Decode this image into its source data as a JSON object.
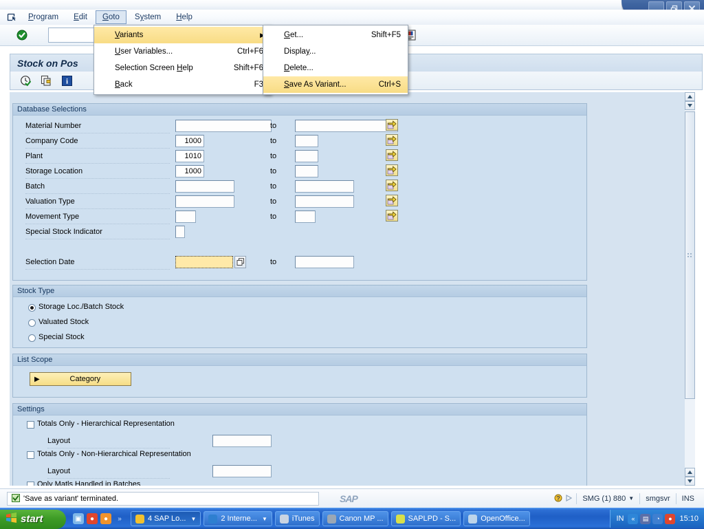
{
  "window": {
    "controls": [
      {
        "name": "minimize",
        "glyph": "minimize-icon"
      },
      {
        "name": "restore",
        "glyph": "restore-icon"
      },
      {
        "name": "close",
        "glyph": "close-icon"
      }
    ]
  },
  "menubar": {
    "system_icon": "system-menu-icon",
    "items": [
      {
        "label": "Program",
        "mnemonic": "P",
        "open": false
      },
      {
        "label": "Edit",
        "mnemonic": "E",
        "open": false
      },
      {
        "label": "Goto",
        "mnemonic": "G",
        "open": true
      },
      {
        "label": "System",
        "mnemonic": "y",
        "open": false
      },
      {
        "label": "Help",
        "mnemonic": "H",
        "open": false
      }
    ]
  },
  "goto_menu": {
    "items": [
      {
        "label": "Variants",
        "mnemonic": "V",
        "shortcut": "",
        "submenu": true,
        "selected": true
      },
      {
        "label": "User Variables...",
        "mnemonic": "U",
        "shortcut": "Ctrl+F6",
        "submenu": false,
        "selected": false
      },
      {
        "label": "Selection Screen Help",
        "mnemonic": "H",
        "shortcut": "Shift+F6",
        "submenu": false,
        "selected": false
      },
      {
        "label": "Back",
        "mnemonic": "B",
        "shortcut": "F3",
        "submenu": false,
        "selected": false
      }
    ]
  },
  "variants_submenu": {
    "items": [
      {
        "label": "Get...",
        "mnemonic": "G",
        "shortcut": "Shift+F5",
        "selected": false
      },
      {
        "label": "Display...",
        "mnemonic": "y",
        "shortcut": "",
        "selected": false
      },
      {
        "label": "Delete...",
        "mnemonic": "D",
        "shortcut": "",
        "selected": false
      },
      {
        "label": "Save As Variant...",
        "mnemonic": "S",
        "shortcut": "Ctrl+S",
        "selected": true
      }
    ]
  },
  "toolbar": {
    "enter_icon": "enter-check-icon",
    "command_field_value": "",
    "right_icons": [
      "help-icon",
      "layout-menu-icon"
    ]
  },
  "screen": {
    "title": "Stock on Pos",
    "app_icons": [
      "execute-clock-icon",
      "multiple-selection-icon",
      "info-icon"
    ]
  },
  "database_selections": {
    "header": "Database Selections",
    "to_label": "to",
    "rows": [
      {
        "label": "Material Number",
        "from": "",
        "to": "",
        "from_w": 140,
        "to_w": 150,
        "select_btn": true
      },
      {
        "label": "Company Code",
        "from": "1000",
        "to": "",
        "from_w": 42,
        "to_w": 34,
        "select_btn": true
      },
      {
        "label": "Plant",
        "from": "1010",
        "to": "",
        "from_w": 42,
        "to_w": 34,
        "select_btn": true
      },
      {
        "label": "Storage Location",
        "from": "1000",
        "to": "",
        "from_w": 42,
        "to_w": 34,
        "select_btn": true
      },
      {
        "label": "Batch",
        "from": "",
        "to": "",
        "from_w": 86,
        "to_w": 86,
        "select_btn": true
      },
      {
        "label": "Valuation Type",
        "from": "",
        "to": "",
        "from_w": 86,
        "to_w": 86,
        "select_btn": true
      },
      {
        "label": "Movement Type",
        "from": "",
        "to": "",
        "from_w": 30,
        "to_w": 30,
        "select_btn": true
      },
      {
        "label": "Special Stock Indicator",
        "from": "",
        "to": null,
        "from_w": 14,
        "to_w": 0,
        "select_btn": false
      }
    ],
    "selection_date": {
      "label": "Selection Date",
      "from": "",
      "to": "",
      "focused": true,
      "matchcode_icon": "matchcode-icon"
    }
  },
  "stock_type": {
    "header": "Stock Type",
    "options": [
      {
        "label": "Storage Loc./Batch Stock",
        "selected": true
      },
      {
        "label": "Valuated Stock",
        "selected": false
      },
      {
        "label": "Special Stock",
        "selected": false
      }
    ]
  },
  "list_scope": {
    "header": "List Scope",
    "category_button": {
      "label": "Category",
      "expand_icon": "triangle-right-icon"
    }
  },
  "settings": {
    "header": "Settings",
    "rows": [
      {
        "type": "checkbox",
        "label": "Totals Only - Hierarchical Representation",
        "checked": false
      },
      {
        "type": "field",
        "label": "Layout",
        "value": ""
      },
      {
        "type": "checkbox",
        "label": "Totals Only - Non-Hierarchical Representation",
        "checked": false
      },
      {
        "type": "field",
        "label": "Layout",
        "value": ""
      },
      {
        "type": "checkbox",
        "label": "Only Matls Handled in Batches",
        "checked": false
      }
    ]
  },
  "statusbar": {
    "message_icon": "status-success-icon",
    "message": "'Save as variant' terminated.",
    "sap_logo": "SAP",
    "help_icon": "help-question-icon",
    "servo_icon": "play-icon",
    "system": "SMG (1) 880",
    "server": "smgsvr",
    "insert_mode": "INS"
  },
  "taskbar": {
    "start_label": "start",
    "quick_launch": [
      {
        "name": "show-desktop-icon",
        "color": "#7fb7e8",
        "glyph": "▣"
      },
      {
        "name": "media-player-icon",
        "color": "#e0462d",
        "glyph": "●"
      },
      {
        "name": "chrome-icon",
        "color": "#f0932b",
        "glyph": "●"
      },
      {
        "name": "more-chevron-icon",
        "color": "transparent",
        "glyph": "»"
      }
    ],
    "buttons": [
      {
        "label": "4 SAP Lo...",
        "icon": "sap-folder-icon",
        "icon_color": "#f2c12e",
        "active": true,
        "dropdown": true
      },
      {
        "label": "2 Interne...",
        "icon": "ie-icon",
        "icon_color": "#2e7fd0",
        "active": false,
        "dropdown": true
      },
      {
        "label": "iTunes",
        "icon": "itunes-icon",
        "icon_color": "#c9d4e2",
        "active": false,
        "dropdown": false
      },
      {
        "label": "Canon MP ...",
        "icon": "printer-icon",
        "icon_color": "#9aa7b5",
        "active": false,
        "dropdown": false
      },
      {
        "label": "SAPLPD - S...",
        "icon": "saplpd-icon",
        "icon_color": "#d8e04a",
        "active": false,
        "dropdown": false
      },
      {
        "label": "OpenOffice...",
        "icon": "openoffice-icon",
        "icon_color": "#bcd4ea",
        "active": false,
        "dropdown": false
      }
    ],
    "tray": {
      "language": "IN",
      "icons": [
        {
          "name": "tray-chevron-icon",
          "color": "#2e86d8",
          "glyph": "«"
        },
        {
          "name": "network-icon",
          "color": "#5b6fa8",
          "glyph": "▤"
        },
        {
          "name": "volume-icon",
          "color": "#3f7fd0",
          "glyph": "◔"
        },
        {
          "name": "media-tray-icon",
          "color": "#e0462d",
          "glyph": "●"
        }
      ],
      "clock": "15:10"
    }
  }
}
